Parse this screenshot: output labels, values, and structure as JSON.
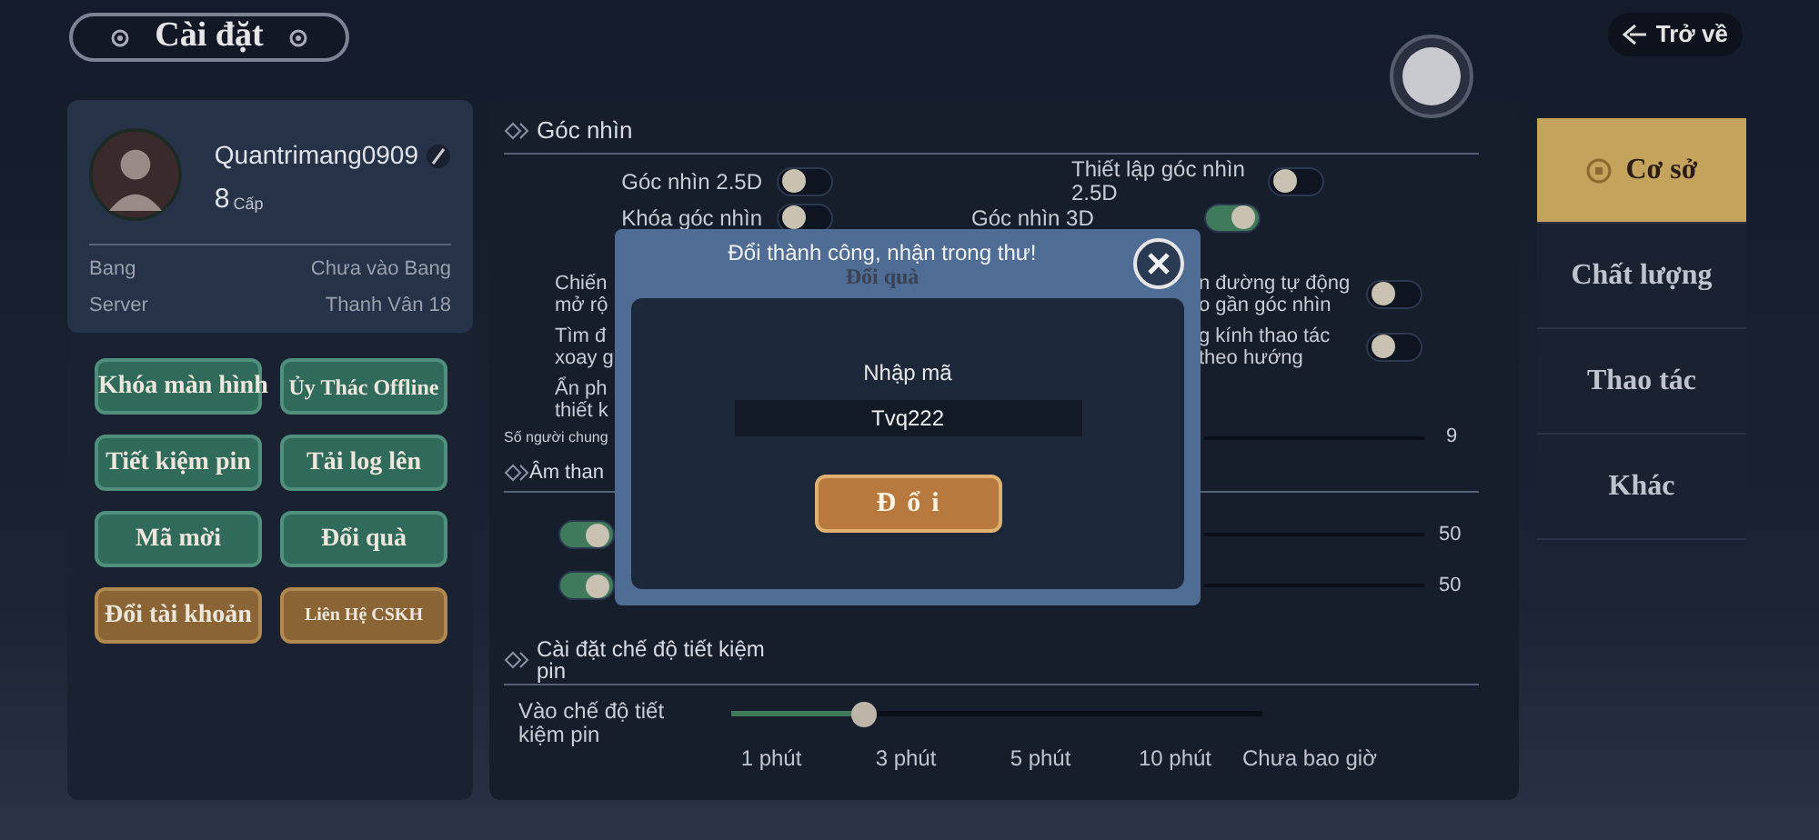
{
  "header": {
    "title": "Cài đặt",
    "back": "Trở về"
  },
  "profile": {
    "name": "Quantrimang0909",
    "level": "8",
    "level_unit": "Cấp",
    "info": [
      {
        "label": "Bang",
        "value": "Chưa vào Bang"
      },
      {
        "label": "Server",
        "value": "Thanh Vân 18"
      }
    ]
  },
  "actions": [
    {
      "label": "Khóa màn hình",
      "kind": "green"
    },
    {
      "label": "Ủy Thác Offline",
      "kind": "green"
    },
    {
      "label": "Tiết kiệm pin",
      "kind": "green"
    },
    {
      "label": "Tải log lên",
      "kind": "green"
    },
    {
      "label": "Mã mời",
      "kind": "green"
    },
    {
      "label": "Đổi quà",
      "kind": "green"
    },
    {
      "label": "Đổi tài khoản",
      "kind": "gold"
    },
    {
      "label": "Liên Hệ CSKH",
      "kind": "gold"
    }
  ],
  "view": {
    "title": "Góc nhìn",
    "toggles": [
      {
        "label": "Góc nhìn 2.5D",
        "on": false
      },
      {
        "label": "Thiết lập góc nhìn 2.5D",
        "on": false
      },
      {
        "label": "Khóa góc nhìn",
        "on": false
      },
      {
        "label": "Góc nhìn 3D",
        "on": true
      }
    ],
    "partial_rows": [
      {
        "left": [
          "Chiến",
          "mở rộ"
        ],
        "right": [
          "n đường tự động",
          "o gần góc nhìn"
        ],
        "on": false
      },
      {
        "left": [
          "Tìm đ",
          "xoay g"
        ],
        "right": [
          "g kính thao tác",
          "theo hướng"
        ],
        "on": false
      },
      {
        "left": [
          "Ẩn ph",
          "thiết k"
        ]
      }
    ],
    "players": {
      "label": "Số người chung",
      "value": "9"
    }
  },
  "sound": {
    "title": "Âm than",
    "rows": [
      {
        "on": true,
        "value": "50"
      },
      {
        "on": true,
        "value": "50"
      }
    ]
  },
  "battery": {
    "title": "Cài đặt chế độ tiết kiệm pin",
    "label": "Vào chế độ tiết kiệm pin",
    "level": 0.25,
    "stops": [
      "1 phút",
      "3 phút",
      "5 phút",
      "10 phút",
      "Chưa bao giờ"
    ]
  },
  "tabs": [
    {
      "label": "Cơ sở",
      "selected": true
    },
    {
      "label": "Chất lượng",
      "selected": false
    },
    {
      "label": "Thao tác",
      "selected": false
    },
    {
      "label": "Khác",
      "selected": false
    }
  ],
  "dialog": {
    "toast": "Đổi thành công, nhận trong thư!",
    "title": "Đổi quà",
    "field_label": "Nhập mã",
    "value": "Tvq222",
    "button": "Đổi"
  }
}
